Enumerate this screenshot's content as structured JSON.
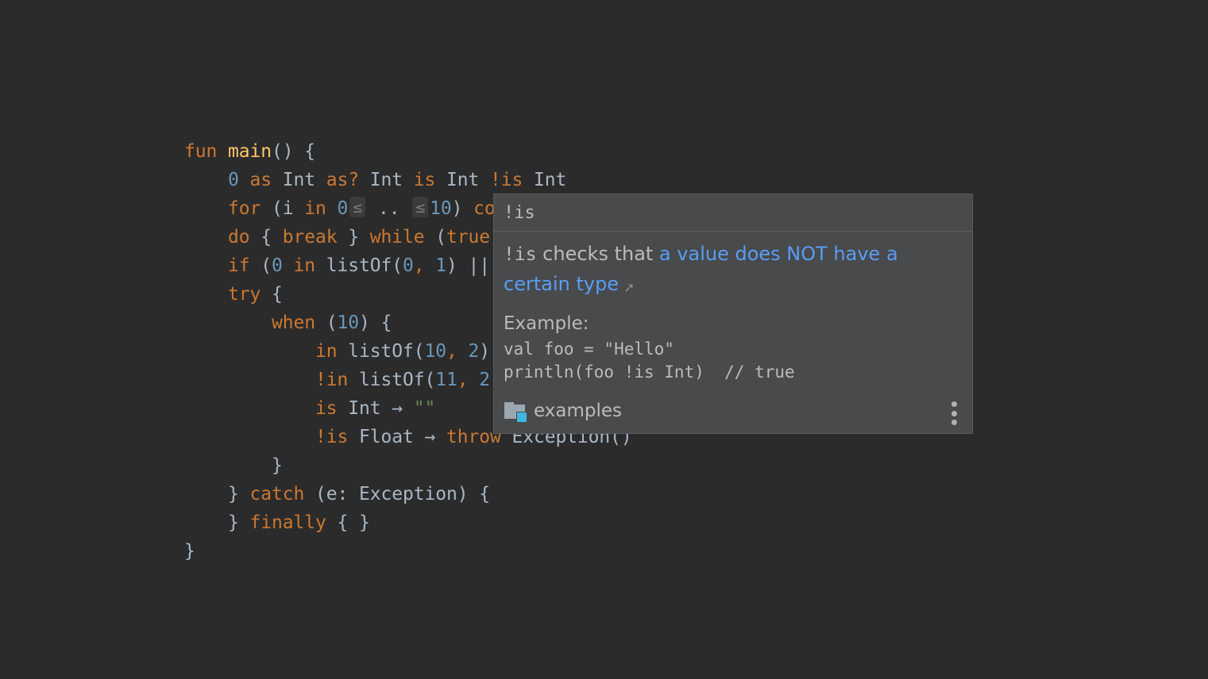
{
  "editor": {
    "lines": [
      [
        {
          "t": "fun",
          "c": "kw"
        },
        {
          "t": " ",
          "c": "plain"
        },
        {
          "t": "main",
          "c": "fn"
        },
        {
          "t": "() {",
          "c": "plain"
        }
      ],
      [
        {
          "t": "    ",
          "c": "plain"
        },
        {
          "t": "0",
          "c": "num"
        },
        {
          "t": " ",
          "c": "plain"
        },
        {
          "t": "as",
          "c": "kw"
        },
        {
          "t": " Int ",
          "c": "plain"
        },
        {
          "t": "as?",
          "c": "kw"
        },
        {
          "t": " Int ",
          "c": "plain"
        },
        {
          "t": "is",
          "c": "kw"
        },
        {
          "t": " Int ",
          "c": "plain"
        },
        {
          "t": "!is",
          "c": "kw"
        },
        {
          "t": " Int",
          "c": "plain"
        }
      ],
      [
        {
          "t": "    ",
          "c": "plain"
        },
        {
          "t": "for",
          "c": "kw"
        },
        {
          "t": " (i ",
          "c": "plain"
        },
        {
          "t": "in",
          "c": "kw"
        },
        {
          "t": " ",
          "c": "plain"
        },
        {
          "t": "0",
          "c": "num"
        },
        {
          "t": "≤",
          "c": "hint"
        },
        {
          "t": " .. ",
          "c": "plain"
        },
        {
          "t": "≤",
          "c": "hint"
        },
        {
          "t": "10",
          "c": "num"
        },
        {
          "t": ") ",
          "c": "plain"
        },
        {
          "t": "continue",
          "c": "kw"
        }
      ],
      [
        {
          "t": "    ",
          "c": "plain"
        },
        {
          "t": "do",
          "c": "kw"
        },
        {
          "t": " { ",
          "c": "plain"
        },
        {
          "t": "break",
          "c": "kw"
        },
        {
          "t": " } ",
          "c": "plain"
        },
        {
          "t": "while",
          "c": "kw"
        },
        {
          "t": " (",
          "c": "plain"
        },
        {
          "t": "true",
          "c": "kw"
        },
        {
          "t": ")",
          "c": "plain"
        }
      ],
      [
        {
          "t": "    ",
          "c": "plain"
        },
        {
          "t": "if",
          "c": "kw"
        },
        {
          "t": " (",
          "c": "plain"
        },
        {
          "t": "0",
          "c": "num"
        },
        {
          "t": " ",
          "c": "plain"
        },
        {
          "t": "in",
          "c": "kw"
        },
        {
          "t": " listOf(",
          "c": "plain"
        },
        {
          "t": "0",
          "c": "num"
        },
        {
          "t": ", ",
          "c": "kw"
        },
        {
          "t": "1",
          "c": "num"
        },
        {
          "t": ") || ",
          "c": "plain"
        }
      ],
      [
        {
          "t": "    ",
          "c": "plain"
        },
        {
          "t": "try",
          "c": "kw"
        },
        {
          "t": " {",
          "c": "plain"
        }
      ],
      [
        {
          "t": "        ",
          "c": "plain"
        },
        {
          "t": "when",
          "c": "kw"
        },
        {
          "t": " (",
          "c": "plain"
        },
        {
          "t": "10",
          "c": "num"
        },
        {
          "t": ") {",
          "c": "plain"
        }
      ],
      [
        {
          "t": "            ",
          "c": "plain"
        },
        {
          "t": "in",
          "c": "kw"
        },
        {
          "t": " listOf(",
          "c": "plain"
        },
        {
          "t": "10",
          "c": "num"
        },
        {
          "t": ", ",
          "c": "kw"
        },
        {
          "t": "2",
          "c": "num"
        },
        {
          "t": ")",
          "c": "plain"
        }
      ],
      [
        {
          "t": "            ",
          "c": "plain"
        },
        {
          "t": "!in",
          "c": "kw"
        },
        {
          "t": " listOf(",
          "c": "plain"
        },
        {
          "t": "11",
          "c": "num"
        },
        {
          "t": ", ",
          "c": "kw"
        },
        {
          "t": "2",
          "c": "num"
        }
      ],
      [
        {
          "t": "            ",
          "c": "plain"
        },
        {
          "t": "is",
          "c": "kw"
        },
        {
          "t": " Int → ",
          "c": "plain"
        },
        {
          "t": "\"\"",
          "c": "str"
        }
      ],
      [
        {
          "t": "            ",
          "c": "plain"
        },
        {
          "t": "!is",
          "c": "kw"
        },
        {
          "t": " Float → ",
          "c": "plain"
        },
        {
          "t": "throw",
          "c": "kw"
        },
        {
          "t": " Exception()",
          "c": "plain"
        }
      ],
      [
        {
          "t": "        }",
          "c": "plain"
        }
      ],
      [
        {
          "t": "    } ",
          "c": "plain"
        },
        {
          "t": "catch",
          "c": "kw"
        },
        {
          "t": " (e: Exception) {",
          "c": "plain"
        }
      ],
      [
        {
          "t": "    } ",
          "c": "plain"
        },
        {
          "t": "finally",
          "c": "kw"
        },
        {
          "t": " { }",
          "c": "plain"
        }
      ],
      [
        {
          "t": "}",
          "c": "plain"
        }
      ]
    ]
  },
  "popup": {
    "title": "!is",
    "description": {
      "code": "!is",
      "text": " checks that ",
      "link": "a value does NOT have a certain type",
      "link_icon": "external-link-arrow"
    },
    "example_label": "Example:",
    "example_code": "val foo = \"Hello\"\nprintln(foo !is Int)  // true",
    "footer": {
      "icon": "folder-icon",
      "label": "examples"
    },
    "more_icon": "more-vertical-icon"
  },
  "colors": {
    "background": "#2b2b2b",
    "keyword": "#cc7832",
    "function": "#ffc66d",
    "number": "#6897bb",
    "string": "#6a8759",
    "text": "#a9b7c6",
    "popup_bg": "#494a4c",
    "link": "#589df6"
  }
}
